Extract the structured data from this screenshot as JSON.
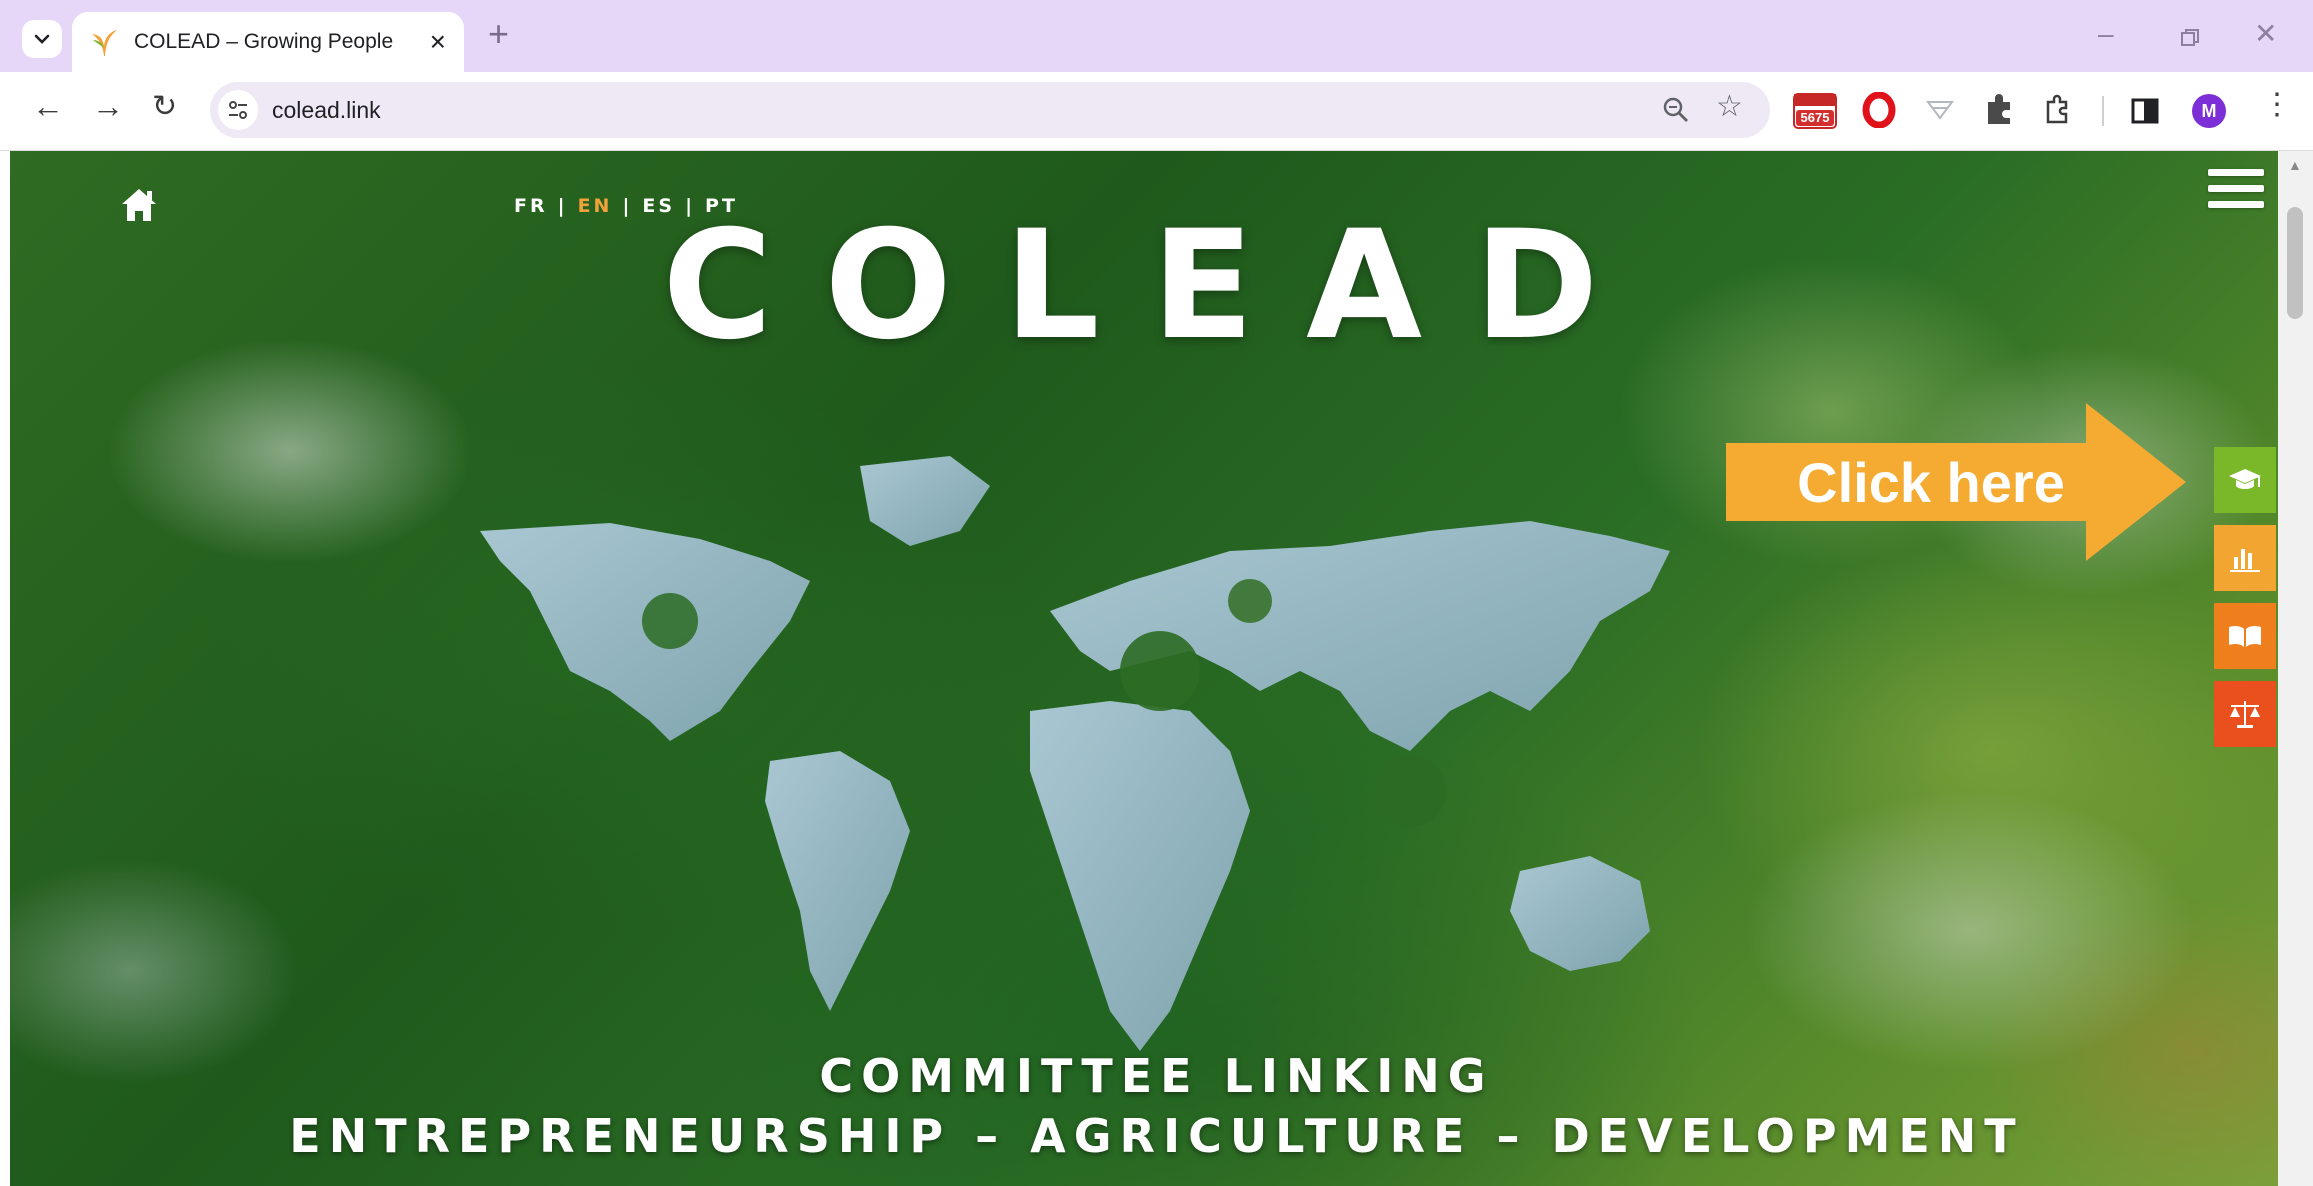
{
  "browser": {
    "tab_title": "COLEAD – Growing People",
    "url": "colead.link",
    "new_tab_label": "+",
    "extension_badge": "5675",
    "profile_initial": "M"
  },
  "page": {
    "languages": [
      "FR",
      "EN",
      "ES",
      "PT"
    ],
    "active_language": "EN",
    "title": "COLEAD",
    "tagline_line1": "COMMITTEE LINKING",
    "tagline_line2": "ENTREPRENEURSHIP – AGRICULTURE – DEVELOPMENT",
    "callout_label": "Click here",
    "side_buttons": [
      {
        "name": "training",
        "icon": "graduation-cap-icon",
        "color": "#7ab829"
      },
      {
        "name": "statistics",
        "icon": "bar-chart-icon",
        "color": "#f2a530"
      },
      {
        "name": "publications",
        "icon": "open-book-icon",
        "color": "#ef7e1d"
      },
      {
        "name": "regulations",
        "icon": "scales-icon",
        "color": "#e9501e"
      }
    ]
  },
  "colors": {
    "tab_bar": "#e6d6f7",
    "callout": "#f5ab32",
    "active_language": "#f2a23a",
    "forest": "#2a6d25"
  }
}
